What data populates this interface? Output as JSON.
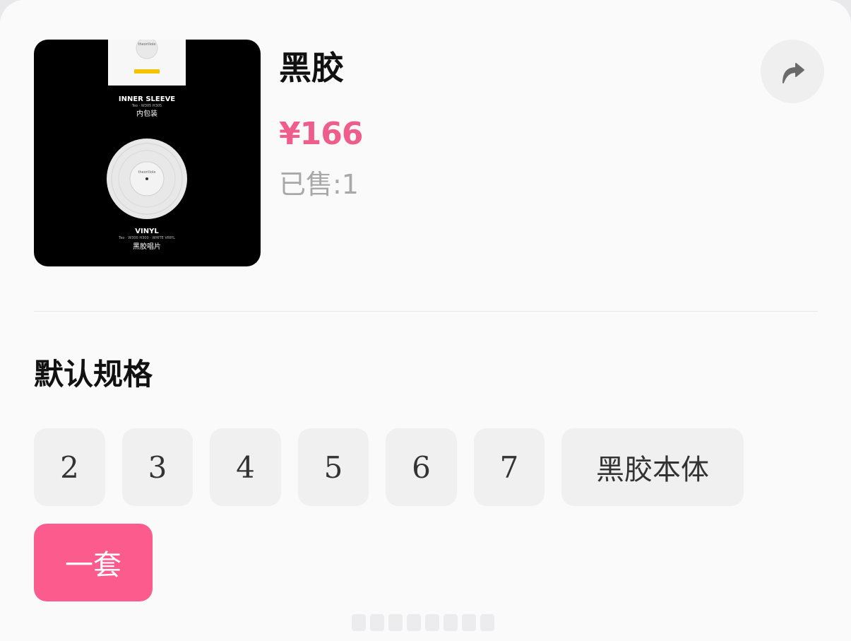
{
  "product": {
    "title": "黑胶",
    "price": "¥166",
    "sold": "已售:1",
    "image": {
      "icon": "vinyl-record-image",
      "inner_sleeve_heading": "INNER SLEEVE",
      "inner_sleeve_spec": "Teo · W305 H305",
      "inner_sleeve_cn": "内包装",
      "vinyl_heading": "VINYL",
      "vinyl_spec": "Teo · W300 H300 · WHITE VINYL",
      "vinyl_cn": "黑胶唱片",
      "brand_text": "theoriliole"
    }
  },
  "share": {
    "icon": "share-arrow-icon"
  },
  "spec": {
    "heading": "默认规格",
    "options": [
      "2",
      "3",
      "4",
      "5",
      "6",
      "7",
      "黑胶本体",
      "一套"
    ],
    "selected": "一套"
  },
  "colors": {
    "accent": "#fb5c8d",
    "price": "#ef5d8c",
    "muted": "#a8a8a8",
    "chip_bg": "#f0f0f1"
  }
}
